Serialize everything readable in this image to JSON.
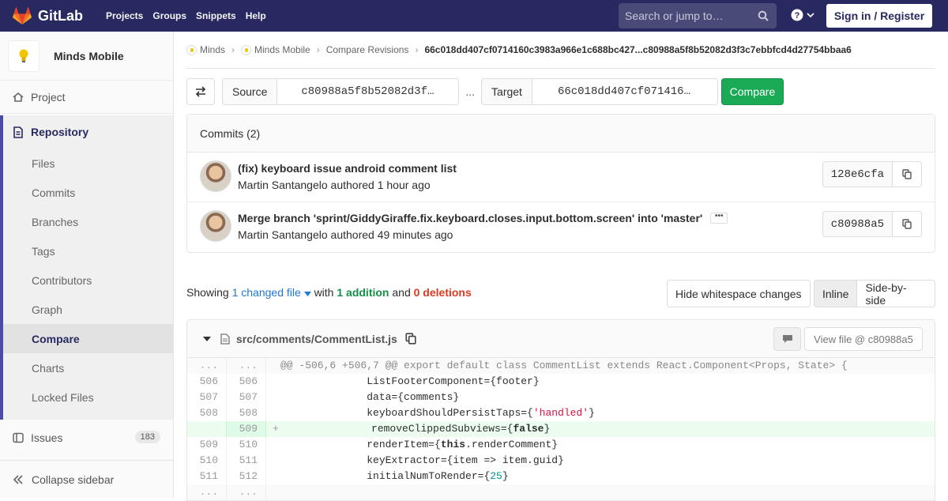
{
  "nav": {
    "brand": "GitLab",
    "links": [
      "Projects",
      "Groups",
      "Snippets",
      "Help"
    ],
    "search_placeholder": "Search or jump to…",
    "signin": "Sign in / Register"
  },
  "sidebar": {
    "project_name": "Minds Mobile",
    "project_label": "Project",
    "repository_label": "Repository",
    "repo_items": [
      "Files",
      "Commits",
      "Branches",
      "Tags",
      "Contributors",
      "Graph",
      "Compare",
      "Charts",
      "Locked Files"
    ],
    "active_item": "Compare",
    "issues_label": "Issues",
    "issues_count": "183",
    "collapse_label": "Collapse sidebar"
  },
  "breadcrumb": {
    "group": "Minds",
    "project": "Minds Mobile",
    "section": "Compare Revisions",
    "current": "66c018dd407cf0714160c3983a966e1c688bc427...c80988a5f8b52082d3f3c7ebbfcd4d27754bbaa6"
  },
  "revision": {
    "source_label": "Source",
    "source_value": "c80988a5f8b52082d3f…",
    "separator": "...",
    "target_label": "Target",
    "target_value": "66c018dd407cf071416…",
    "compare_label": "Compare"
  },
  "commits": {
    "header": "Commits (2)",
    "items": [
      {
        "title": "(fix) keyboard issue android comment list",
        "author": "Martin Santangelo",
        "verb": "authored",
        "time": "1 hour ago",
        "sha": "128e6cfa"
      },
      {
        "title": "Merge branch 'sprint/GiddyGiraffe.fix.keyboard.closes.input.bottom.screen' into 'master'",
        "author": "Martin Santangelo",
        "verb": "authored",
        "time": "49 minutes ago",
        "sha": "c80988a5"
      }
    ]
  },
  "diffstats": {
    "showing": "Showing",
    "changed": "1 changed file",
    "with": "with",
    "additions": "1 addition",
    "and": "and",
    "deletions": "0 deletions"
  },
  "view_options": {
    "whitespace": "Hide whitespace changes",
    "inline": "Inline",
    "side_by_side": "Side-by-side"
  },
  "file": {
    "path": "src/comments/CommentList.js",
    "view_file": "View file @ c80988a5",
    "lines": [
      {
        "type": "match",
        "old": "...",
        "new": "...",
        "sign": "",
        "code": "@@ -506,6 +506,7 @@ export default class CommentList extends React.Component<Props, State> {"
      },
      {
        "type": "ctx",
        "old": "506",
        "new": "506",
        "sign": "",
        "code": "              ListFooterComponent={footer}"
      },
      {
        "type": "ctx",
        "old": "507",
        "new": "507",
        "sign": "",
        "code": "              data={comments}"
      },
      {
        "type": "ctx",
        "old": "508",
        "new": "508",
        "sign": "",
        "code": "              keyboardShouldPersistTaps={'handled'}"
      },
      {
        "type": "added",
        "old": "",
        "new": "509",
        "sign": "+",
        "code": "              removeClippedSubviews={false}"
      },
      {
        "type": "ctx",
        "old": "509",
        "new": "510",
        "sign": "",
        "code": "              renderItem={this.renderComment}"
      },
      {
        "type": "ctx",
        "old": "510",
        "new": "511",
        "sign": "",
        "code": "              keyExtractor={item => item.guid}"
      },
      {
        "type": "ctx",
        "old": "511",
        "new": "512",
        "sign": "",
        "code": "              initialNumToRender={25}"
      },
      {
        "type": "match",
        "old": "...",
        "new": "...",
        "sign": "",
        "code": ""
      }
    ]
  }
}
